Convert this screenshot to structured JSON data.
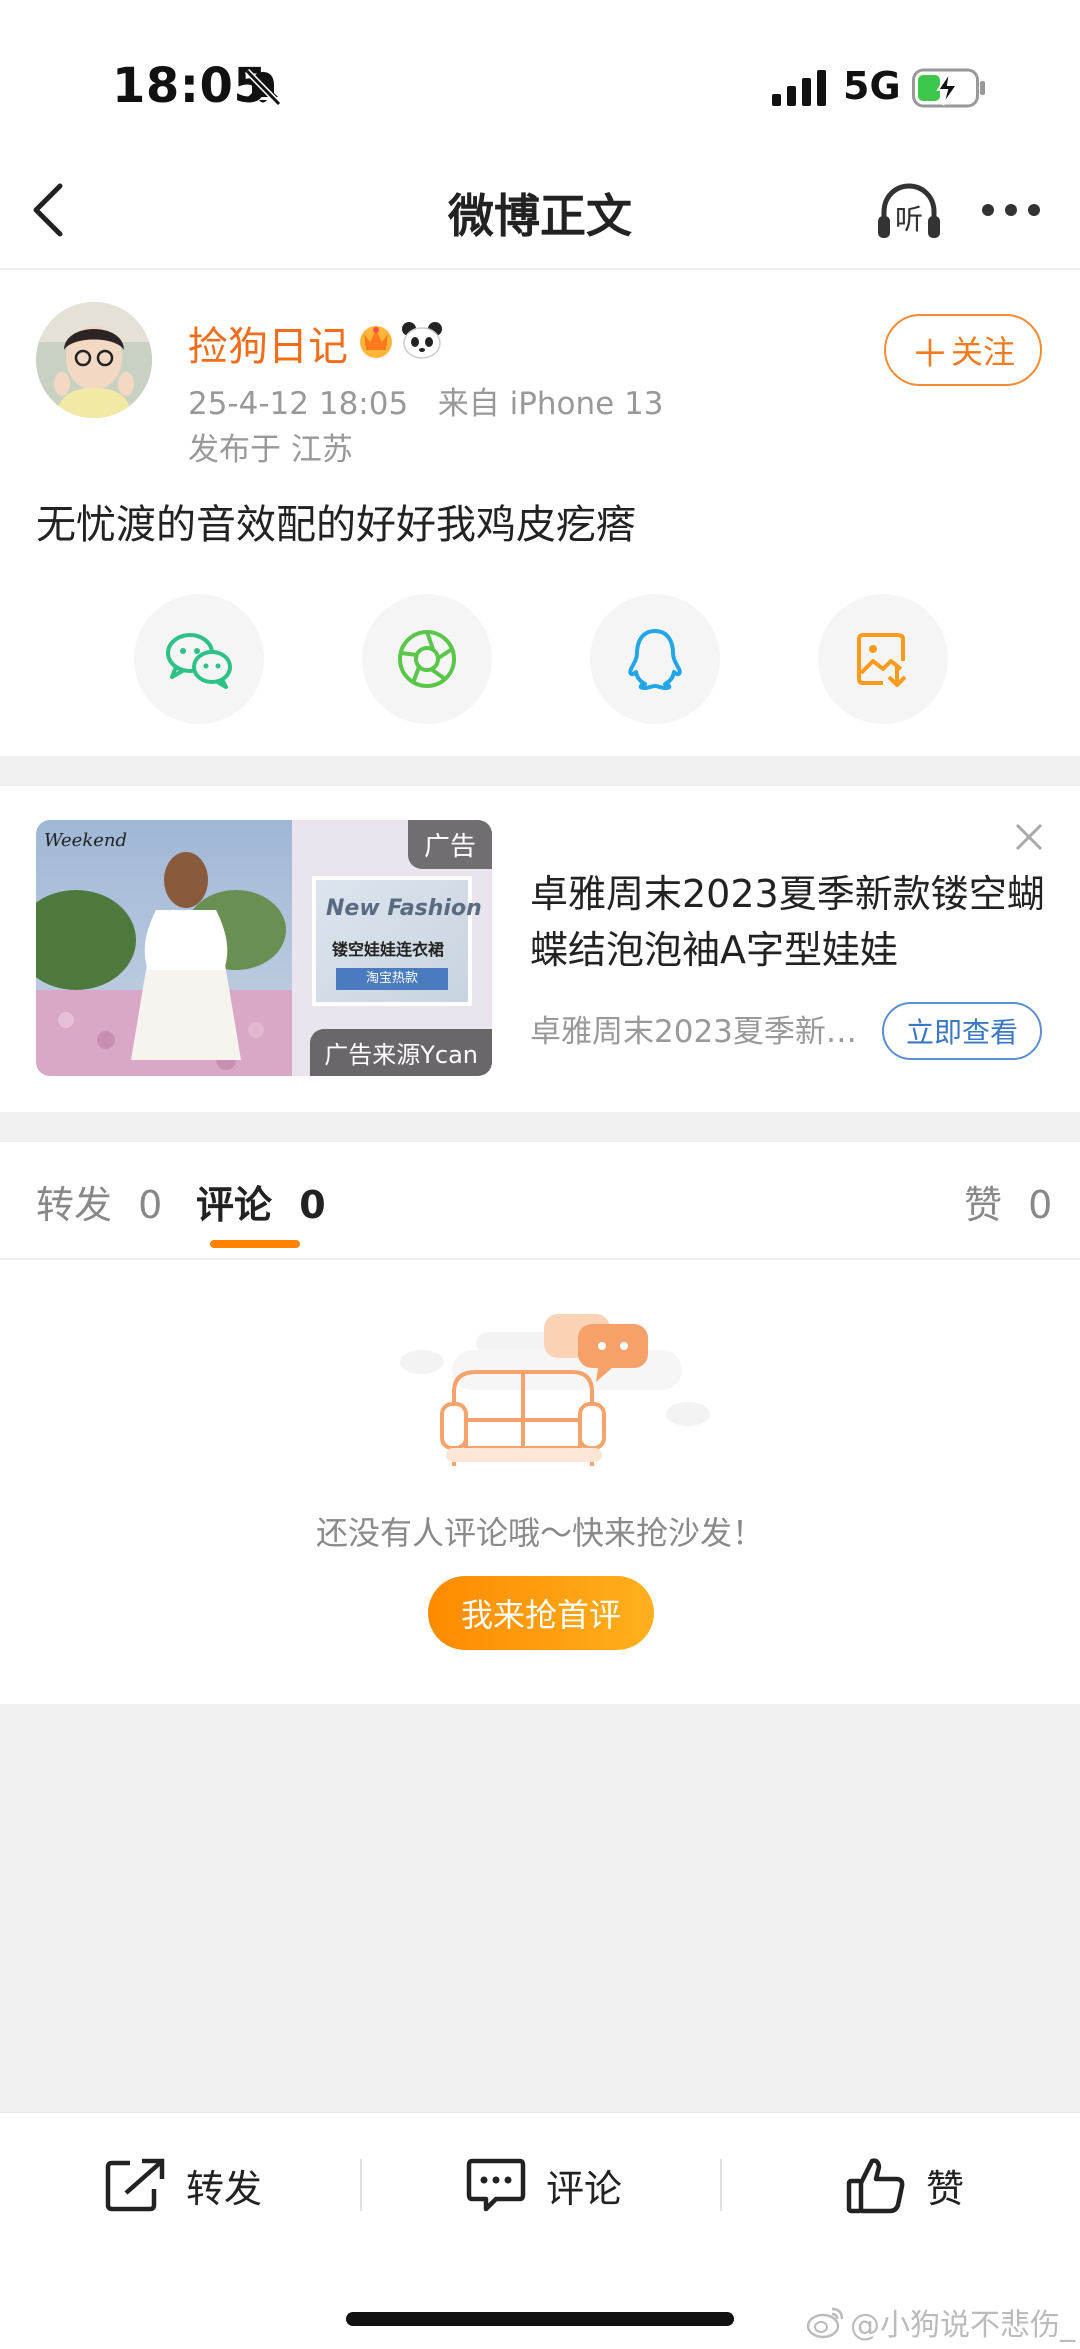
{
  "status_bar": {
    "time": "18:05",
    "network": "5G"
  },
  "nav": {
    "title": "微博正文",
    "listen_label": "听"
  },
  "post": {
    "author": "捡狗日记",
    "meta": "25-4-12 18:05   来自 iPhone 13",
    "location": "发布于 江苏",
    "follow_label": "关注",
    "text": "无忧渡的音效配的好好我鸡皮疙瘩"
  },
  "share": [
    "wechat-icon",
    "moments-icon",
    "qq-icon",
    "save-image-icon"
  ],
  "ad": {
    "badge": "广告",
    "source": "广告来源Ycan",
    "title": "卓雅周末2023夏季新款镂空蝴蝶结泡泡袖A字型娃娃",
    "subtitle": "卓雅周末2023夏季新…",
    "cta": "立即查看",
    "image_brand": "Weekend",
    "image_headline": "New Fashion",
    "image_caption": "镂空娃娃连衣裙",
    "image_tag": "淘宝热款"
  },
  "tabs": {
    "repost": {
      "label": "转发",
      "count": "0"
    },
    "comment": {
      "label": "评论",
      "count": "0"
    },
    "like": {
      "label": "赞",
      "count": "0"
    }
  },
  "empty_state": {
    "message": "还没有人评论哦～快来抢沙发！",
    "button": "我来抢首评"
  },
  "toolbar": {
    "repost": "转发",
    "comment": "评论",
    "like": "赞"
  },
  "watermark": "@小狗说不悲伤_",
  "colors": {
    "accent": "#ff8200",
    "author": "#f26d1a",
    "link": "#3a78c5"
  }
}
